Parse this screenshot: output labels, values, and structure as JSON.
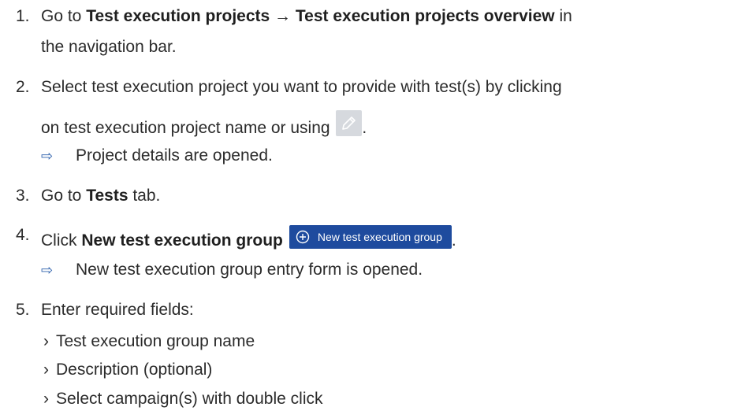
{
  "steps": [
    {
      "number": "1.",
      "text_before": "Go to ",
      "bold1": "Test execution projects",
      "arrow": " → ",
      "bold2": "Test execution projects overview",
      "text_after": " in",
      "continuation": "the navigation bar."
    },
    {
      "number": "2.",
      "text": "Select test execution project you want to provide with test(s) by clicking",
      "continuation": "on test execution project name or using",
      "icon": "pencil-edit-icon",
      "trailing": ".",
      "result": "Project details are opened."
    },
    {
      "number": "3.",
      "text_before": "Go to ",
      "bold": "Tests",
      "text_after": " tab."
    },
    {
      "number": "4.",
      "text_before": "Click ",
      "bold": "New test execution group",
      "button_label": "New test execution group",
      "button_icon": "plus-circle-icon",
      "trailing": ".",
      "result": "New test execution group entry form is opened."
    },
    {
      "number": "5.",
      "text": "Enter required fields:",
      "subitems": [
        "Test execution group name",
        "Description (optional)",
        "Select campaign(s) with double click"
      ]
    }
  ],
  "result_arrow": "⇨",
  "subitem_marker": "›",
  "colors": {
    "button_bg": "#1e4b9e",
    "icon_box": "#d6d9de",
    "arrow": "#2b5fab"
  }
}
